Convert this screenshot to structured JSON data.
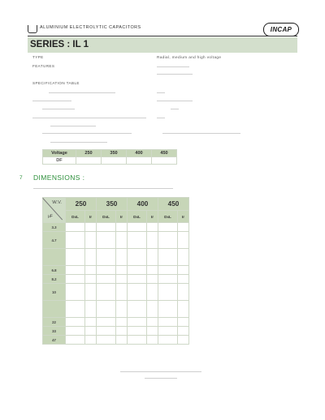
{
  "header": {
    "title": "ALUMINIUM ELECTROLYTIC CAPACITORS",
    "brand": "INCAP",
    "icon": "capacitor-cup-icon"
  },
  "series_title": "SERIES : IL 1",
  "type_label": "TYPE",
  "type_value": "Radial, medium and high voltage",
  "features_label": "FEATURES",
  "spec_heading": "SPECIFICATION TABLE",
  "df_table": {
    "row_labels": [
      "Voltage",
      "DF"
    ],
    "voltages": [
      "250",
      "350",
      "400",
      "450"
    ]
  },
  "dimensions": {
    "number": "7",
    "title": "DIMENSIONS :",
    "corner_top": "W.V.",
    "corner_bottom": "µF",
    "voltages": [
      "250",
      "350",
      "400",
      "450"
    ],
    "sub_dl": "DxL",
    "sub_ir": "Ir",
    "capacitances": [
      "3.3",
      "4.7",
      "",
      "6.8",
      "8.2",
      "10",
      "",
      "22",
      "33",
      "47"
    ]
  },
  "colors": {
    "band": "#d3dfcc",
    "header_cell": "#c7d6b8",
    "section_title": "#2c8f3a"
  }
}
